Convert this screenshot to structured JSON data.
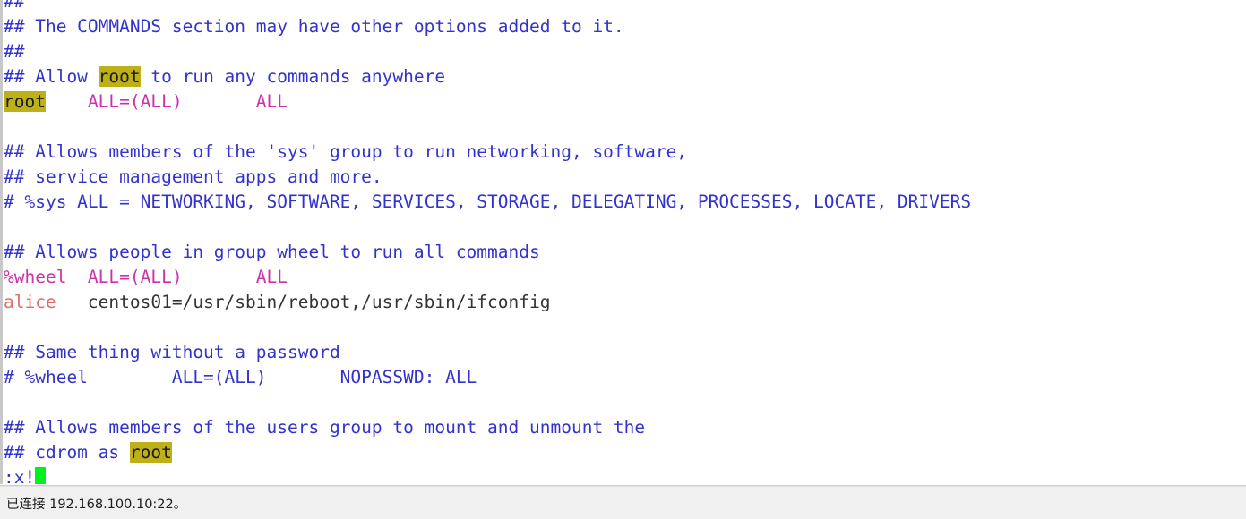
{
  "window": {
    "kind": "ssh-terminal-vi-editor",
    "file_context": "/etc/sudoers"
  },
  "terminal": {
    "colors": {
      "comment": "#3333cc",
      "magenta": "#cc33aa",
      "salmon": "#dd6f6a",
      "plain": "#333333",
      "search_highlight_bg": "#bdb018",
      "search_highlight_fg": "#1a1a1a",
      "cursor": "#00f11d",
      "background": "#ffffff"
    },
    "search_term": "root",
    "lines": [
      {
        "id": "line-1",
        "segments": [
          {
            "text": "##",
            "style": "comment"
          }
        ]
      },
      {
        "id": "line-2",
        "segments": [
          {
            "text": "## The COMMANDS section may have other options added to it.",
            "style": "comment"
          }
        ]
      },
      {
        "id": "line-3",
        "segments": [
          {
            "text": "##",
            "style": "comment"
          }
        ]
      },
      {
        "id": "line-4",
        "segments": [
          {
            "text": "## Allow ",
            "style": "comment"
          },
          {
            "text": "root",
            "style": "highlight"
          },
          {
            "text": " to run any commands anywhere",
            "style": "comment"
          }
        ]
      },
      {
        "id": "line-5",
        "segments": [
          {
            "text": "root",
            "style": "highlight"
          },
          {
            "text": "    ",
            "style": "plain"
          },
          {
            "text": "ALL=(ALL)       ALL",
            "style": "magenta"
          }
        ]
      },
      {
        "id": "line-6",
        "segments": [
          {
            "text": "",
            "style": "plain"
          }
        ]
      },
      {
        "id": "line-7",
        "segments": [
          {
            "text": "## Allows members of the 'sys' group to run networking, software,",
            "style": "comment"
          }
        ]
      },
      {
        "id": "line-8",
        "segments": [
          {
            "text": "## service management apps and more.",
            "style": "comment"
          }
        ]
      },
      {
        "id": "line-9",
        "segments": [
          {
            "text": "# %sys ALL = NETWORKING, SOFTWARE, SERVICES, STORAGE, DELEGATING, PROCESSES, LOCATE, DRIVERS",
            "style": "comment"
          }
        ]
      },
      {
        "id": "line-10",
        "segments": [
          {
            "text": "",
            "style": "plain"
          }
        ]
      },
      {
        "id": "line-11",
        "segments": [
          {
            "text": "## Allows people in group wheel to run all commands",
            "style": "comment"
          }
        ]
      },
      {
        "id": "line-12",
        "segments": [
          {
            "text": "%wheel  ALL=(ALL)       ALL",
            "style": "magenta"
          }
        ]
      },
      {
        "id": "line-13",
        "segments": [
          {
            "text": "alice",
            "style": "salmon"
          },
          {
            "text": "   centos01=/usr/sbin/reboot,/usr/sbin/ifconfig",
            "style": "plain"
          }
        ]
      },
      {
        "id": "line-14",
        "segments": [
          {
            "text": "",
            "style": "plain"
          }
        ]
      },
      {
        "id": "line-15",
        "segments": [
          {
            "text": "## Same thing without a password",
            "style": "comment"
          }
        ]
      },
      {
        "id": "line-16",
        "segments": [
          {
            "text": "# %wheel        ALL=(ALL)       NOPASSWD: ALL",
            "style": "comment"
          }
        ]
      },
      {
        "id": "line-17",
        "segments": [
          {
            "text": "",
            "style": "plain"
          }
        ]
      },
      {
        "id": "line-18",
        "segments": [
          {
            "text": "## Allows members of the users group to mount and unmount the",
            "style": "comment"
          }
        ]
      },
      {
        "id": "line-19",
        "segments": [
          {
            "text": "## cdrom as ",
            "style": "comment"
          },
          {
            "text": "root",
            "style": "highlight"
          }
        ]
      },
      {
        "id": "line-20",
        "segments": [
          {
            "text": ":x!",
            "style": "comment"
          },
          {
            "text": " ",
            "style": "cursor"
          }
        ]
      }
    ],
    "command_line": ":x!"
  },
  "statusbar": {
    "text": "已连接 192.168.100.10:22。",
    "connection_state": "已连接",
    "host": "192.168.100.10",
    "port": "22"
  }
}
